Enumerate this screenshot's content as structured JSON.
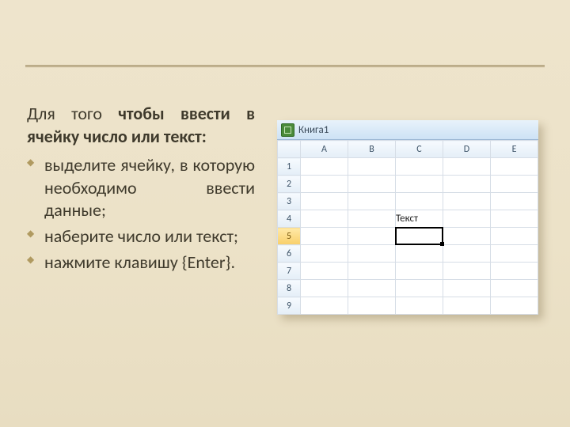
{
  "text": {
    "lead_plain": "Для того ",
    "lead_bold": "чтобы ввести в ячейку число или текст:",
    "bullets": [
      "выделите ячейку, в которую необходимо ввести данные;",
      " наберите число или текст;",
      "нажмите клавишу {Enter}."
    ]
  },
  "excel": {
    "workbook_title": "Книга1",
    "columns": [
      "A",
      "B",
      "C",
      "D",
      "E"
    ],
    "rows": [
      "1",
      "2",
      "3",
      "4",
      "5",
      "6",
      "7",
      "8",
      "9"
    ],
    "selected_col_index": 2,
    "selected_row_index": 4,
    "cells": {
      "C4": "Текст"
    }
  }
}
